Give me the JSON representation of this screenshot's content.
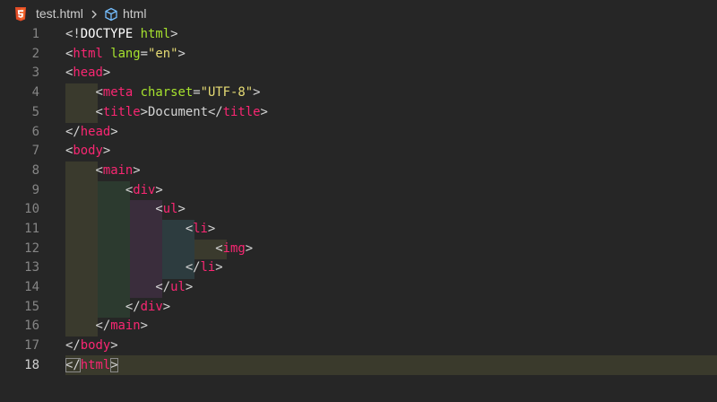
{
  "breadcrumb": {
    "file_name": "test.html",
    "symbol": "html",
    "file_icon": "html5-icon",
    "separator_icon": "chevron-right-icon",
    "symbol_icon": "cube-icon"
  },
  "editor": {
    "current_line": 18,
    "line_numbers": [
      "1",
      "2",
      "3",
      "4",
      "5",
      "6",
      "7",
      "8",
      "9",
      "10",
      "11",
      "12",
      "13",
      "14",
      "15",
      "16",
      "17",
      "18"
    ],
    "lines": [
      "<!DOCTYPE html>",
      "<html lang=\"en\">",
      "<head>",
      "    <meta charset=\"UTF-8\">",
      "    <title>Document</title>",
      "</head>",
      "<body>",
      "    <main>",
      "        <div>",
      "            <ul>",
      "                <li>",
      "                    <img>",
      "                </li>",
      "            </ul>",
      "        </div>",
      "    </main>",
      "</body>",
      "</html>"
    ]
  },
  "colors": {
    "background": "#262626",
    "tag": "#f92672",
    "attribute": "#a6e22e",
    "string": "#e6db74",
    "punctuation": "#d4d4d4",
    "line_number": "#858585",
    "current_line_highlight": "#3a3a2c"
  }
}
